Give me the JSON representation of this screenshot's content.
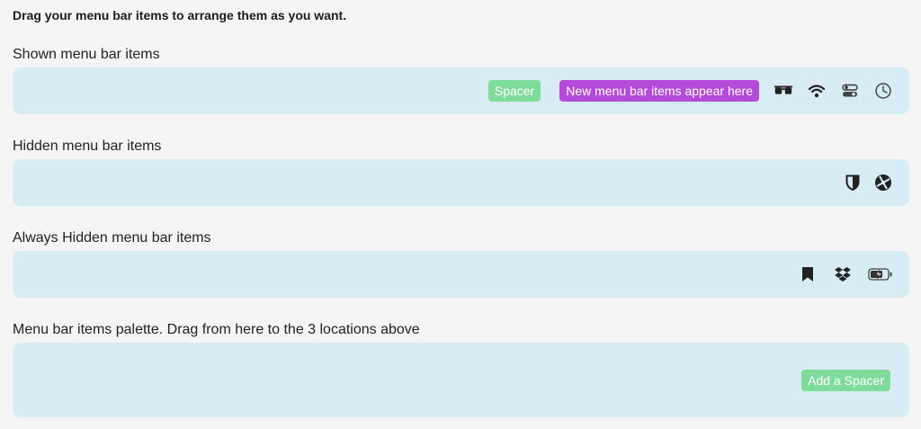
{
  "instructions": "Drag your menu bar items to arrange them as you want.",
  "colors": {
    "zone_background": "#d7edf3",
    "spacer_pill": "#7fdc9b",
    "new_items_pill": "#b44ad9",
    "page_background": "#f5f5f5"
  },
  "shown": {
    "label": "Shown menu bar items",
    "spacer_label": "Spacer",
    "new_items_label": "New menu bar items appear here",
    "icons": [
      "glasses-icon",
      "wifi-icon",
      "control-center-icon",
      "clock-icon"
    ]
  },
  "hidden": {
    "label": " Hidden menu bar items",
    "icons": [
      "shield-icon",
      "aperture-icon"
    ]
  },
  "always_hidden": {
    "label": "Always Hidden menu bar items",
    "icons": [
      "bookmark-icon",
      "dropbox-icon",
      "battery-charging-icon"
    ]
  },
  "palette": {
    "label": "Menu bar items palette. Drag from here to the 3 locations above",
    "add_spacer_label": "Add a Spacer"
  }
}
